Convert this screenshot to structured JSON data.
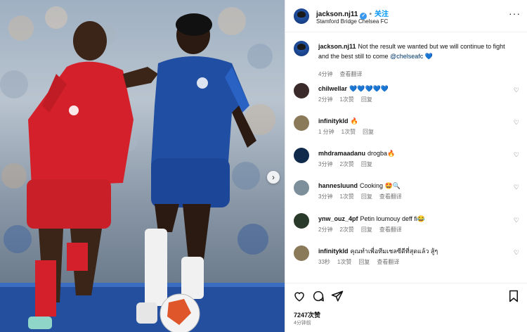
{
  "post": {
    "username": "jackson.nj11",
    "follow_label": "关注",
    "location": "Stamford Bridge Chelsea FC",
    "caption_user": "jackson.nj11",
    "caption": "Not the result we wanted but we will continue to fight and the best still to come",
    "caption_mention": "@chelseafc",
    "caption_emoji": "💙",
    "caption_time": "4分钟",
    "caption_translate": "查看翻译"
  },
  "comments": [
    {
      "user": "chilwellar",
      "text": "💙💙💙💙💙",
      "time": "2分钟",
      "likes": "1次赞",
      "reply": "回复",
      "translate": ""
    },
    {
      "user": "infinitykld",
      "text": "🔥",
      "time": "1 分钟",
      "likes": "1次赞",
      "reply": "回复",
      "translate": ""
    },
    {
      "user": "mhdramaadanu",
      "text": "drogba🔥",
      "time": "3分钟",
      "likes": "2次赞",
      "reply": "回复",
      "translate": ""
    },
    {
      "user": "hannesluund",
      "text": "Cooking 🤩🔍",
      "time": "3分钟",
      "likes": "1次赞",
      "reply": "回复",
      "translate": "查看翻译"
    },
    {
      "user": "ynw_ouz_4pf",
      "text": "Petin loumouy deff fi😂",
      "time": "2分钟",
      "likes": "2次赞",
      "reply": "回复",
      "translate": "查看翻译"
    },
    {
      "user": "infinitykld",
      "text": "คุณทำเพื่อทีมเชลซีดีที่สุดแล้ว สู้ๆ",
      "time": "33秒",
      "likes": "1次赞",
      "reply": "回复",
      "translate": "查看翻译"
    }
  ],
  "footer": {
    "likes_count": "7247次赞",
    "time_ago": "4分钟前"
  },
  "icons": {
    "heart": "heart-icon",
    "comment": "comment-icon",
    "share": "share-icon",
    "bookmark": "bookmark-icon"
  },
  "colors": {
    "link_blue": "#0095f6",
    "verified_blue": "#3897f0",
    "chelsea_blue": "#1f4ea3",
    "liverpool_red": "#d4202a"
  }
}
